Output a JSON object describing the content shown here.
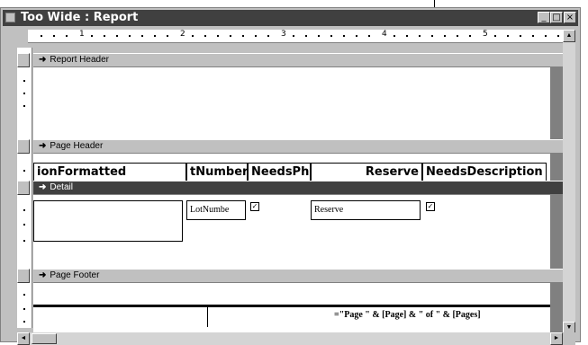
{
  "window": {
    "title": "Too Wide : Report",
    "controls": {
      "minimize": "_",
      "maximize": "□",
      "close": "×"
    }
  },
  "ruler": {
    "labels": [
      "1",
      "2",
      "3",
      "4",
      "5"
    ]
  },
  "sections": {
    "report_header": "Report Header",
    "page_header": "Page Header",
    "detail": "Detail",
    "page_footer": "Page Footer"
  },
  "page_header_fields": [
    "ionFormatted",
    "tNumber",
    "NeedsPh",
    "Reserve",
    "NeedsDescription"
  ],
  "detail_fields": {
    "lot_number": "LotNumbe",
    "reserve": "Reserve",
    "checkbox_mark": "✓"
  },
  "page_footer": {
    "expression": "=\"Page \" & [Page] & \" of \" & [Pages]"
  },
  "icons": {
    "band_arrow": "arrow-icon",
    "scroll_up": "▲",
    "scroll_down": "▼",
    "scroll_left": "◄",
    "scroll_right": "►"
  },
  "colors": {
    "window_bg": "#c0c0c0",
    "title_bar": "#404040",
    "detail_band": "#404040"
  }
}
